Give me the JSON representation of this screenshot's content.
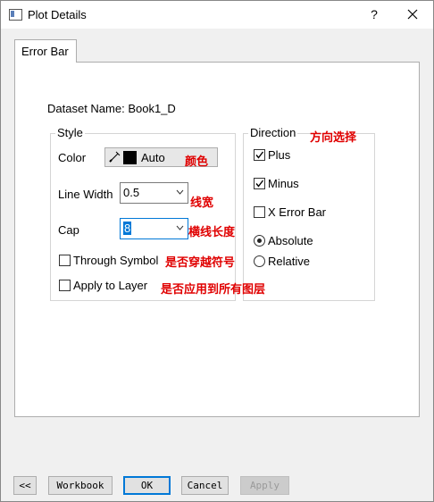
{
  "window": {
    "title": "Plot Details",
    "help_label": "?"
  },
  "tabs": [
    {
      "label": "Error Bar"
    }
  ],
  "dataset": {
    "label": "Dataset Name: Book1_D"
  },
  "style": {
    "title": "Style",
    "color_label": "Color",
    "color_value": "Auto",
    "color_swatch": "#000000",
    "line_width_label": "Line Width",
    "line_width_value": "0.5",
    "cap_label": "Cap",
    "cap_value": "8",
    "through_symbol_label": "Through Symbol",
    "through_symbol_checked": false,
    "apply_to_layer_label": "Apply to Layer",
    "apply_to_layer_checked": false
  },
  "direction": {
    "title": "Direction",
    "plus_label": "Plus",
    "plus_checked": true,
    "minus_label": "Minus",
    "minus_checked": true,
    "x_error_bar_label": "X Error Bar",
    "x_error_bar_checked": false,
    "absolute_label": "Absolute",
    "relative_label": "Relative",
    "selected_mode": "Absolute"
  },
  "annotations": {
    "direction": "方向选择",
    "color": "颜色",
    "line_width": "线宽",
    "cap": "横线长度",
    "through_symbol": "是否穿越符号",
    "apply_to_layer": "是否应用到所有图层",
    "color_hex": "#e00000"
  },
  "buttons": {
    "collapse": "<<",
    "workbook": "Workbook",
    "ok": "OK",
    "cancel": "Cancel",
    "apply": "Apply"
  }
}
